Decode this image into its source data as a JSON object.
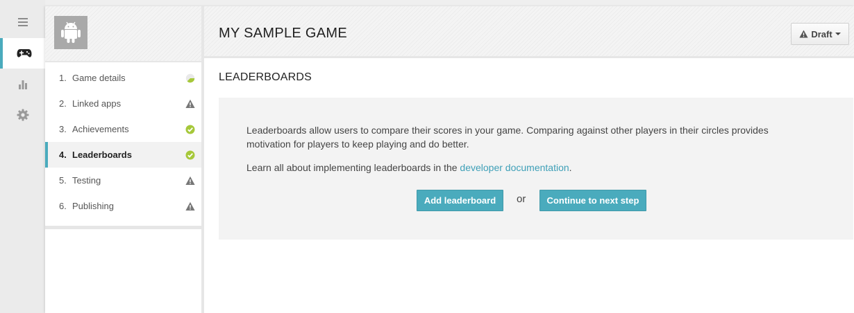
{
  "rail": {
    "items": [
      {
        "icon": "menu-icon"
      },
      {
        "icon": "gamepad-icon",
        "active": true
      },
      {
        "icon": "bar-chart-icon"
      },
      {
        "icon": "gear-icon"
      }
    ]
  },
  "game": {
    "title": "MY SAMPLE GAME",
    "icon": "android-icon"
  },
  "status": {
    "label": "Draft",
    "icon": "warning-icon"
  },
  "steps": [
    {
      "num": "1.",
      "label": "Game details",
      "status": "partial"
    },
    {
      "num": "2.",
      "label": "Linked apps",
      "status": "warning"
    },
    {
      "num": "3.",
      "label": "Achievements",
      "status": "complete"
    },
    {
      "num": "4.",
      "label": "Leaderboards",
      "status": "complete",
      "active": true
    },
    {
      "num": "5.",
      "label": "Testing",
      "status": "warning"
    },
    {
      "num": "6.",
      "label": "Publishing",
      "status": "warning"
    }
  ],
  "section": {
    "title": "LEADERBOARDS",
    "description": "Leaderboards allow users to compare their scores in your game. Comparing against other players in their circles provides motivation for players to keep playing and do better.",
    "learn_prefix": "Learn all about implementing leaderboards in the ",
    "learn_link": "developer documentation",
    "learn_suffix": ".",
    "add_button": "Add leaderboard",
    "or_text": "or",
    "next_button": "Continue to next step"
  },
  "colors": {
    "accent": "#4aabbd",
    "complete": "#a6c83a",
    "warning": "#777777"
  }
}
